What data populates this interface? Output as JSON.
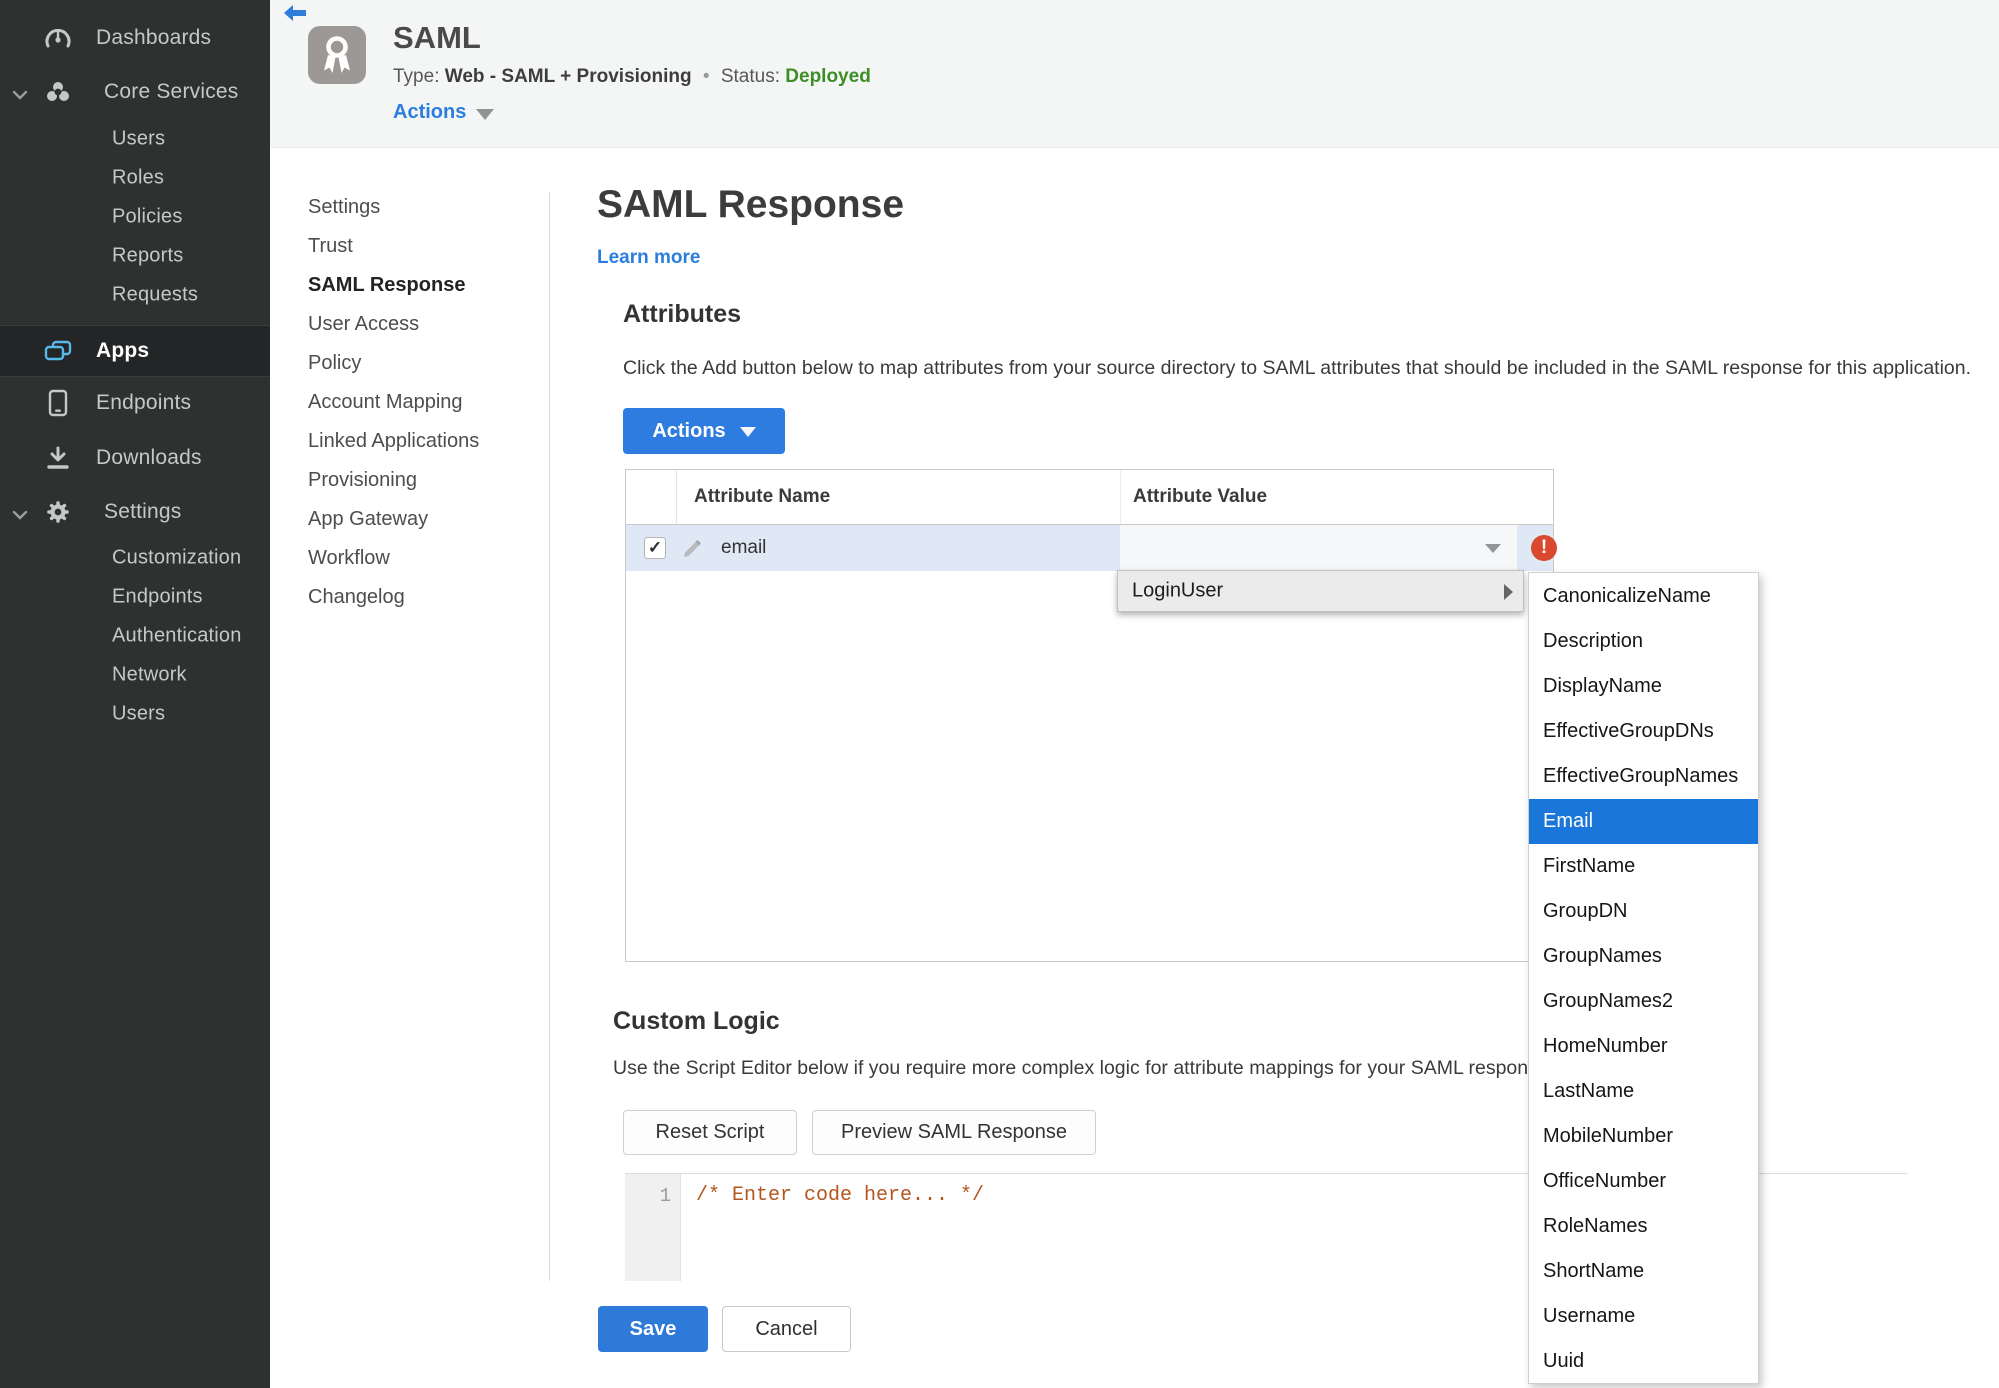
{
  "colors": {
    "accent_blue": "#2b7de0",
    "selected_blue": "#1b76d9",
    "status_green": "#3e8e27",
    "error_red": "#d9482f",
    "sidebar_bg": "#2f3030",
    "row_highlight": "#dfe9f6",
    "code_comment": "#b5551e"
  },
  "sidebar": {
    "items": [
      {
        "label": "Dashboards"
      },
      {
        "label": "Core Services"
      },
      {
        "label": "Users"
      },
      {
        "label": "Roles"
      },
      {
        "label": "Policies"
      },
      {
        "label": "Reports"
      },
      {
        "label": "Requests"
      },
      {
        "label": "Apps"
      },
      {
        "label": "Endpoints"
      },
      {
        "label": "Downloads"
      },
      {
        "label": "Settings"
      },
      {
        "label": "Customization"
      },
      {
        "label": "Endpoints"
      },
      {
        "label": "Authentication"
      },
      {
        "label": "Network"
      },
      {
        "label": "Users"
      }
    ],
    "active_item": "Apps"
  },
  "header": {
    "app_title": "SAML",
    "type_label": "Type:",
    "type_value": "Web - SAML + Provisioning",
    "separator": "•",
    "status_label": "Status:",
    "status_value": "Deployed",
    "actions_label": "Actions"
  },
  "nav": {
    "items": [
      "Settings",
      "Trust",
      "SAML Response",
      "User Access",
      "Policy",
      "Account Mapping",
      "Linked Applications",
      "Provisioning",
      "App Gateway",
      "Workflow",
      "Changelog"
    ],
    "active_item": "SAML Response"
  },
  "main": {
    "title": "SAML Response",
    "learn_more": "Learn more",
    "attributes": {
      "heading": "Attributes",
      "description": "Click the Add button below to map attributes from your source directory to SAML attributes that should be included in the SAML response for this application.",
      "actions_button": "Actions",
      "table": {
        "columns": [
          "Attribute Name",
          "Attribute Value"
        ],
        "rows": [
          {
            "name": "email",
            "value": "",
            "checked": true,
            "error": true
          }
        ]
      }
    },
    "custom_logic": {
      "heading": "Custom Logic",
      "description": "Use the Script Editor below if you require more complex logic for attribute mappings for your SAML response.",
      "reset_button": "Reset Script",
      "preview_button": "Preview SAML Response",
      "editor": {
        "line_number": "1",
        "code": "/* Enter code here... */"
      }
    },
    "save_button": "Save",
    "cancel_button": "Cancel"
  },
  "dropdown_menu": {
    "label": "LoginUser",
    "selected": "Email",
    "submenu": [
      "CanonicalizeName",
      "Description",
      "DisplayName",
      "EffectiveGroupDNs",
      "EffectiveGroupNames",
      "Email",
      "FirstName",
      "GroupDN",
      "GroupNames",
      "GroupNames2",
      "HomeNumber",
      "LastName",
      "MobileNumber",
      "OfficeNumber",
      "RoleNames",
      "ShortName",
      "Username",
      "Uuid"
    ]
  }
}
